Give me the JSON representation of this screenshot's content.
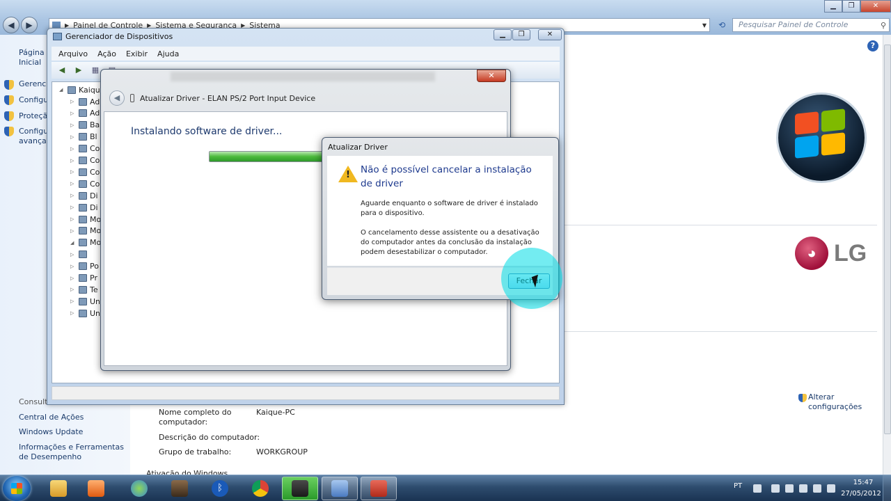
{
  "control_panel": {
    "address": [
      "Painel de Controle",
      "Sistema e Segurança",
      "Sistema"
    ],
    "search_placeholder": "Pesquisar Painel de Controle",
    "left_links": [
      "Página Inicial do Painel de Controle",
      "Gerenciador de Dispositivos",
      "Configurações remotas",
      "Proteção do sistema",
      "Configurações avançadas do sistema"
    ],
    "see_also_header": "Consulte também",
    "see_also": [
      "Central de Ações",
      "Windows Update",
      "Informações e Ferramentas de Desempenho"
    ],
    "info_labels": [
      "Nome completo do computador:",
      "Descrição do computador:",
      "Grupo de trabalho:"
    ],
    "info_values": [
      "Kaique-PC",
      "",
      "WORKGROUP"
    ],
    "activation_label": "Ativação do Windows",
    "change_settings": "Alterar configurações",
    "brand": "LG",
    "brand_short": "LG"
  },
  "device_manager": {
    "title": "Gerenciador de Dispositivos",
    "menu": [
      "Arquivo",
      "Ação",
      "Exibir",
      "Ajuda"
    ],
    "tree_root": "Kaique-PC",
    "tree_partial": [
      "Ad",
      "Ad",
      "Ba",
      "Bl",
      "Co",
      "Co",
      "Co",
      "Co",
      "Di",
      "Di",
      "Mo",
      "Mo",
      "Mo",
      "",
      "Po",
      "Pr",
      "Te",
      "Un",
      "Un"
    ]
  },
  "update_driver": {
    "breadcrumb": "Atualizar Driver - ELAN PS/2 Port Input Device",
    "installing": "Instalando software de driver...",
    "progress": 0.45
  },
  "alert": {
    "title": "Atualizar Driver",
    "heading": "Não é possível cancelar a instalação de driver",
    "text1": "Aguarde enquanto o software de driver é instalado para o dispositivo.",
    "text2": "O cancelamento desse assistente ou a desativação do computador antes da conclusão da instalação podem desestabilizar o computador.",
    "close_button": "Fechar"
  },
  "taskbar": {
    "language": "PT",
    "time": "15:47",
    "date": "27/05/2012"
  },
  "colors": {
    "accent_blue": "#1e3a8e",
    "warning": "#f0b820",
    "cursor_highlight": "#00dce6"
  }
}
